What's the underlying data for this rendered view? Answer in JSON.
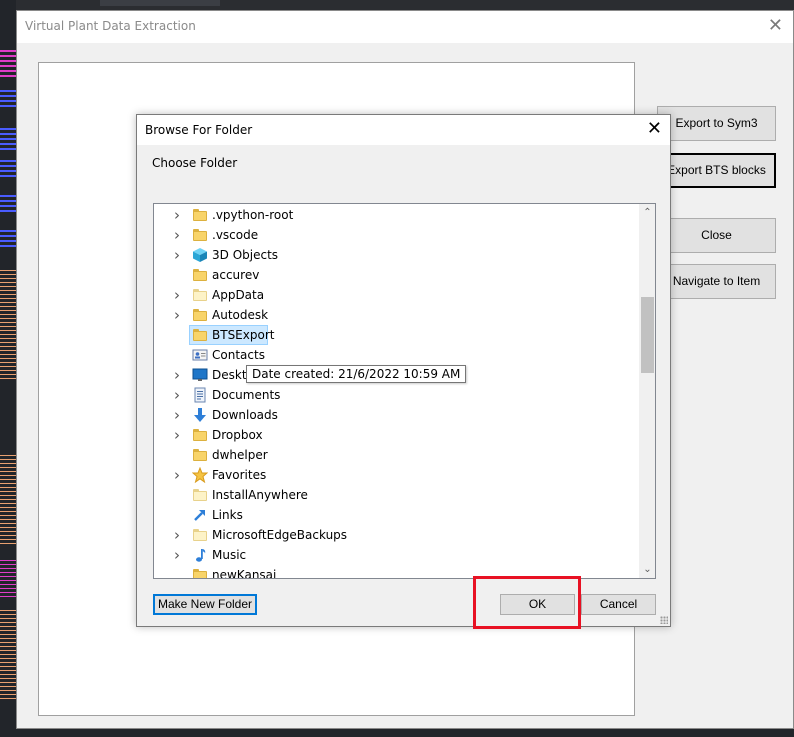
{
  "main_window": {
    "title": "Virtual Plant Data Extraction",
    "close_glyph": "✕",
    "buttons": {
      "export_sym3": "Export to Sym3",
      "export_bts": "Export BTS blocks",
      "close": "Close",
      "navigate": "Navigate to Item"
    }
  },
  "dialog": {
    "title": "Browse For Folder",
    "close_glyph": "✕",
    "subtitle": "Choose Folder",
    "tooltip": "Date created: 21/6/2022 10:59 AM",
    "selected_item": "BTSExport",
    "items": [
      {
        "label": ".vpython-root",
        "icon": "folder-icon",
        "expandable": true
      },
      {
        "label": ".vscode",
        "icon": "folder-icon",
        "expandable": true
      },
      {
        "label": "3D Objects",
        "icon": "3d-objects-icon",
        "expandable": true
      },
      {
        "label": "accurev",
        "icon": "folder-icon",
        "expandable": false
      },
      {
        "label": "AppData",
        "icon": "folder-icon",
        "expandable": true
      },
      {
        "label": "Autodesk",
        "icon": "folder-icon",
        "expandable": true
      },
      {
        "label": "BTSExport",
        "icon": "folder-icon",
        "expandable": false
      },
      {
        "label": "Contacts",
        "icon": "contacts-icon",
        "expandable": false
      },
      {
        "label": "Deskto",
        "icon": "desktop-icon",
        "expandable": true
      },
      {
        "label": "Documents",
        "icon": "documents-icon",
        "expandable": true
      },
      {
        "label": "Downloads",
        "icon": "downloads-icon",
        "expandable": true
      },
      {
        "label": "Dropbox",
        "icon": "folder-icon",
        "expandable": true
      },
      {
        "label": "dwhelper",
        "icon": "folder-icon",
        "expandable": false
      },
      {
        "label": "Favorites",
        "icon": "favorites-icon",
        "expandable": true
      },
      {
        "label": "InstallAnywhere",
        "icon": "folder-icon",
        "expandable": false
      },
      {
        "label": "Links",
        "icon": "links-icon",
        "expandable": false
      },
      {
        "label": "MicrosoftEdgeBackups",
        "icon": "folder-icon",
        "expandable": true
      },
      {
        "label": "Music",
        "icon": "music-icon",
        "expandable": true
      },
      {
        "label": "newKansai",
        "icon": "folder-icon",
        "expandable": false
      }
    ],
    "buttons": {
      "make_new_folder": "Make New Folder",
      "ok": "OK",
      "cancel": "Cancel"
    }
  },
  "colors": {
    "highlight_box": "#e81123",
    "selection_bg": "#cce8ff",
    "focus_border": "#0078d7"
  }
}
